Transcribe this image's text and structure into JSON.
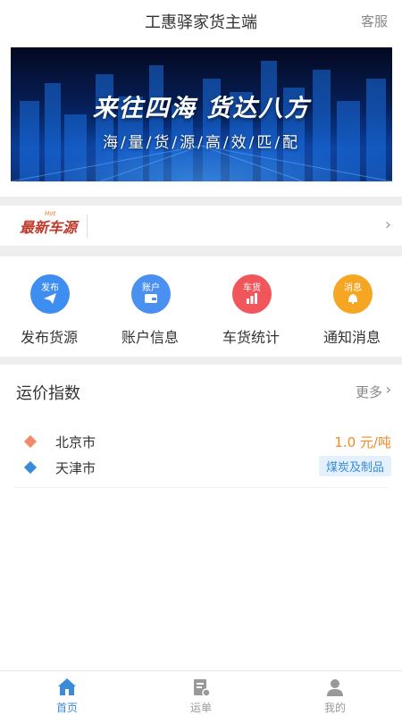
{
  "header": {
    "title": "工惠驿家货主端",
    "service": "客服"
  },
  "banner": {
    "slogan": "来往四海 货达八方",
    "subtitle": "海/量/货/源/高/效/匹/配"
  },
  "news": {
    "logo": "最新车源",
    "hot": "Hot"
  },
  "menu": [
    {
      "badge": "发布",
      "label": "发布货源",
      "color": "#3d8ef0",
      "icon": "send-icon"
    },
    {
      "badge": "账户",
      "label": "账户信息",
      "color": "#4a90f0",
      "icon": "wallet-icon"
    },
    {
      "badge": "车货",
      "label": "车货统计",
      "color": "#f0565a",
      "icon": "chart-icon"
    },
    {
      "badge": "消息",
      "label": "通知消息",
      "color": "#f5a623",
      "icon": "bell-icon"
    }
  ],
  "index": {
    "title": "运价指数",
    "more": "更多",
    "origin": {
      "city": "北京市",
      "price": "1.0 元/吨"
    },
    "destination": {
      "city": "天津市",
      "tag": "煤炭及制品"
    }
  },
  "tabbar": [
    {
      "label": "首页",
      "icon": "home-icon",
      "active": true
    },
    {
      "label": "运单",
      "icon": "waybill-icon",
      "active": false
    },
    {
      "label": "我的",
      "icon": "user-icon",
      "active": false
    }
  ],
  "colors": {
    "accent": "#3b8bd8",
    "price": "#f08a24",
    "originDot": "#f08a6a",
    "destinationDot": "#3b8bd8"
  }
}
